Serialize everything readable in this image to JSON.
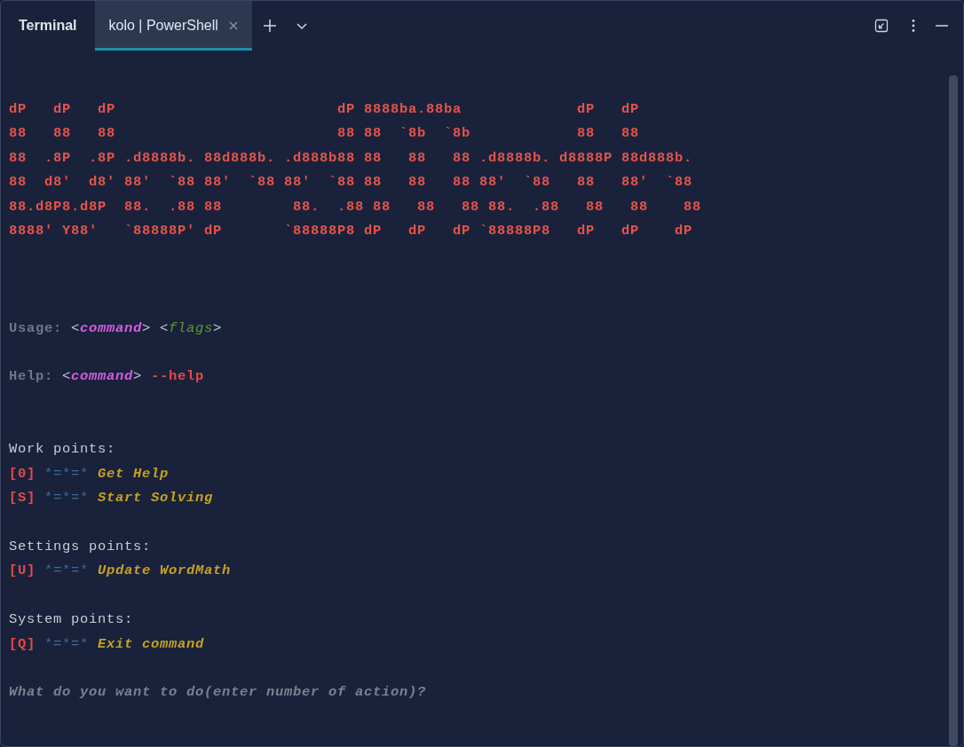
{
  "header": {
    "title": "Terminal",
    "tabs": [
      {
        "label": "kolo | PowerShell",
        "selected": true
      }
    ]
  },
  "lines": [
    {
      "kind": "text",
      "segments": [
        {
          "kind": "art",
          "text": "dP   dP   dP                         dP 8888ba.88ba             dP   dP"
        }
      ]
    },
    {
      "kind": "text",
      "segments": [
        {
          "kind": "art",
          "text": "88   88   88                         88 88  `8b  `8b            88   88"
        }
      ]
    },
    {
      "kind": "text",
      "segments": [
        {
          "kind": "art",
          "text": "88  .8P  .8P .d8888b. 88d888b. .d888b88 88   88   88 .d8888b. d8888P 88d888b."
        }
      ]
    },
    {
      "kind": "text",
      "segments": [
        {
          "kind": "art",
          "text": "88  d8'  d8' 88'  `88 88'  `88 88'  `88 88   88   88 88'  `88   88   88'  `88"
        }
      ]
    },
    {
      "kind": "text",
      "segments": [
        {
          "kind": "art",
          "text": "88.d8P8.d8P  88.  .88 88        88.  .88 88   88   88 88.  .88   88   88    88"
        }
      ]
    },
    {
      "kind": "text",
      "segments": [
        {
          "kind": "art",
          "text": "8888' Y88'   `88888P' dP       `88888P8 dP   dP   dP `88888P8   dP   dP    dP"
        }
      ]
    },
    {
      "kind": "blank"
    },
    {
      "kind": "blank"
    },
    {
      "kind": "blank"
    },
    {
      "kind": "text",
      "segments": [
        {
          "kind": "label",
          "text": "Usage: "
        },
        {
          "kind": "angle",
          "text": "<"
        },
        {
          "kind": "command",
          "text": "command"
        },
        {
          "kind": "angle",
          "text": "> <"
        },
        {
          "kind": "flags",
          "text": "flags"
        },
        {
          "kind": "angle",
          "text": ">"
        }
      ]
    },
    {
      "kind": "blank"
    },
    {
      "kind": "text",
      "segments": [
        {
          "kind": "label",
          "text": "Help: "
        },
        {
          "kind": "angle",
          "text": "<"
        },
        {
          "kind": "command",
          "text": "command"
        },
        {
          "kind": "angle",
          "text": "> "
        },
        {
          "kind": "option",
          "text": "--help"
        }
      ]
    },
    {
      "kind": "blank"
    },
    {
      "kind": "blank"
    },
    {
      "kind": "text",
      "segments": [
        {
          "kind": "heading",
          "text": "Work points:"
        }
      ]
    },
    {
      "kind": "text",
      "segments": [
        {
          "kind": "key",
          "text": "[0]"
        },
        {
          "kind": "stars",
          "text": " *=*=* "
        },
        {
          "kind": "action",
          "text": "Get Help"
        }
      ]
    },
    {
      "kind": "text",
      "segments": [
        {
          "kind": "key",
          "text": "[S]"
        },
        {
          "kind": "stars",
          "text": " *=*=* "
        },
        {
          "kind": "action",
          "text": "Start Solving"
        }
      ]
    },
    {
      "kind": "blank"
    },
    {
      "kind": "text",
      "segments": [
        {
          "kind": "heading",
          "text": "Settings points:"
        }
      ]
    },
    {
      "kind": "text",
      "segments": [
        {
          "kind": "key",
          "text": "[U]"
        },
        {
          "kind": "stars",
          "text": " *=*=* "
        },
        {
          "kind": "action",
          "text": "Update WordMath"
        }
      ]
    },
    {
      "kind": "blank"
    },
    {
      "kind": "text",
      "segments": [
        {
          "kind": "heading",
          "text": "System points:"
        }
      ]
    },
    {
      "kind": "text",
      "segments": [
        {
          "kind": "key",
          "text": "[Q]"
        },
        {
          "kind": "stars",
          "text": " *=*=* "
        },
        {
          "kind": "action",
          "text": "Exit command"
        }
      ]
    },
    {
      "kind": "blank"
    },
    {
      "kind": "text",
      "segments": [
        {
          "kind": "prompt",
          "text": "What do you want to do(enter number of action)?"
        }
      ]
    }
  ]
}
